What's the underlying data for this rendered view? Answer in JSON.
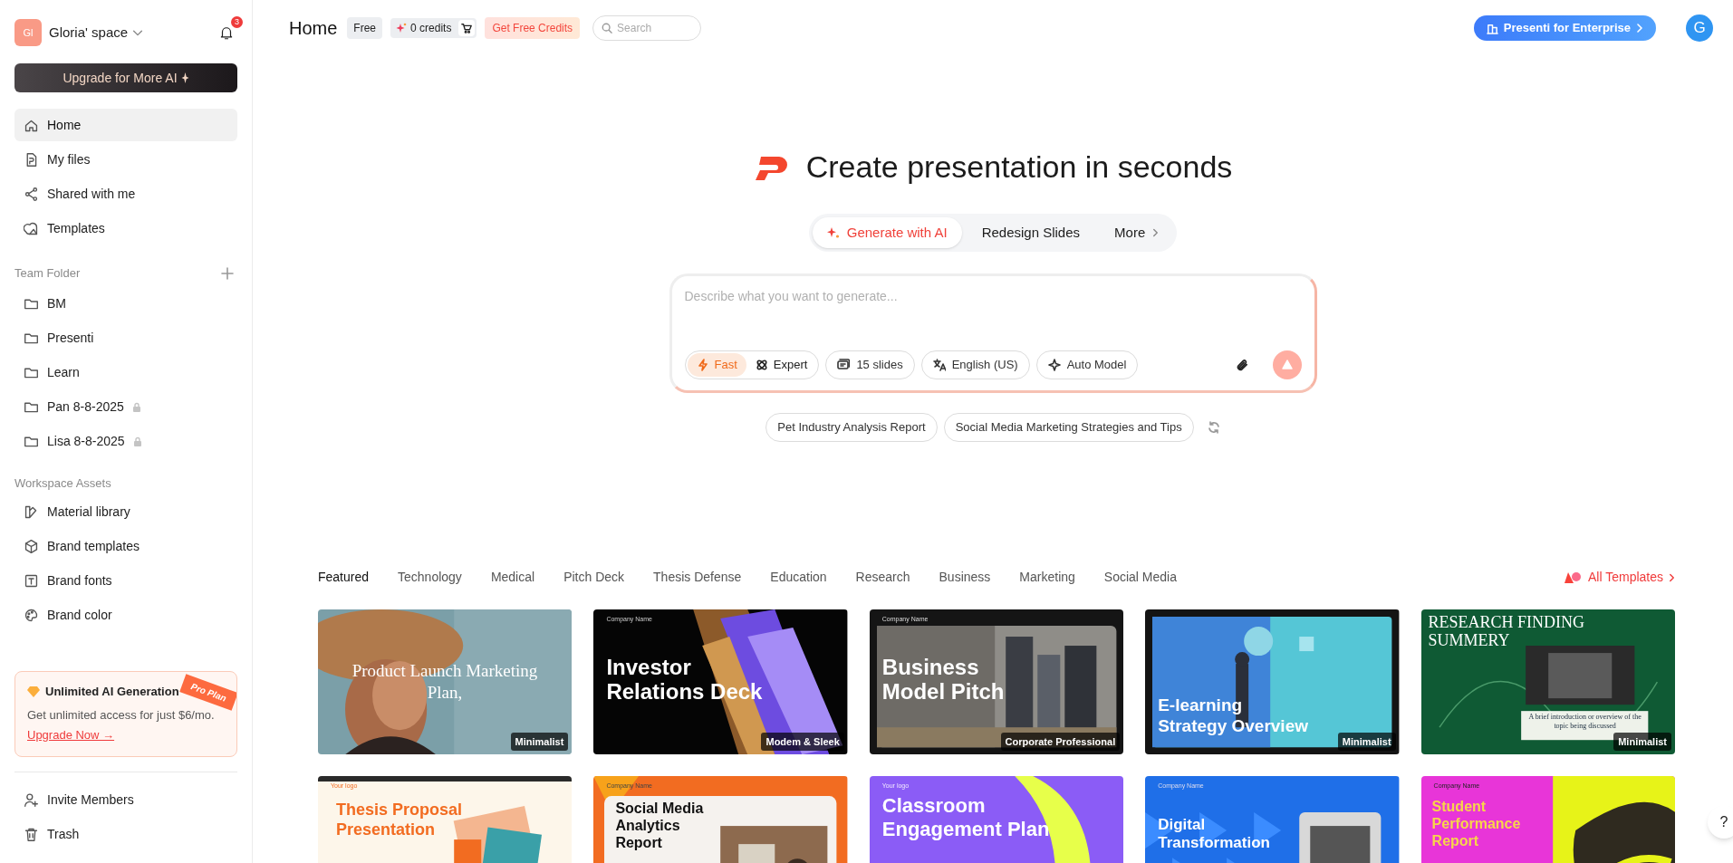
{
  "workspace": {
    "avatar": "Gl",
    "name": "Gloria' space",
    "notifications": "3"
  },
  "upgrade_button": "Upgrade for More AI",
  "nav": [
    {
      "label": "Home",
      "selected": true
    },
    {
      "label": "My files",
      "selected": false
    },
    {
      "label": "Shared with me",
      "selected": false
    },
    {
      "label": "Templates",
      "selected": false
    }
  ],
  "team_folder": {
    "title": "Team Folder",
    "items": [
      {
        "label": "BM",
        "locked": false
      },
      {
        "label": "Presenti",
        "locked": false
      },
      {
        "label": "Learn",
        "locked": false
      },
      {
        "label": "Pan 8-8-2025",
        "locked": true
      },
      {
        "label": "Lisa 8-8-2025",
        "locked": true
      }
    ]
  },
  "workspace_assets": {
    "title": "Workspace Assets",
    "items": [
      "Material library",
      "Brand templates",
      "Brand fonts",
      "Brand color"
    ]
  },
  "promo": {
    "title": "Unlimited AI Generation",
    "text": "Get unlimited access for just $6/mo.",
    "link": "Upgrade Now →",
    "ribbon": "Pro Plan"
  },
  "bottom_nav": [
    "Invite Members",
    "Trash"
  ],
  "topbar": {
    "title": "Home",
    "plan": "Free",
    "credits": "0 credits",
    "free_credits": "Get Free Credits",
    "search_placeholder": "Search",
    "enterprise": "Presenti for Enterprise",
    "user_initial": "G"
  },
  "hero": {
    "title": "Create presentation in seconds",
    "modes": [
      {
        "label": "Generate with AI",
        "selected": true
      },
      {
        "label": "Redesign Slides",
        "selected": false
      },
      {
        "label": "More",
        "selected": false
      }
    ],
    "prompt": {
      "placeholder": "Describe what you want to generate...",
      "speed": [
        {
          "label": "Fast",
          "selected": true
        },
        {
          "label": "Expert",
          "selected": false
        }
      ],
      "options": [
        "15 slides",
        "English (US)",
        "Auto Model"
      ]
    },
    "suggestions": [
      "Pet Industry Analysis Report",
      "Social Media Marketing Strategies and Tips"
    ]
  },
  "templates": {
    "categories": [
      {
        "label": "Featured",
        "selected": true
      },
      {
        "label": "Technology",
        "selected": false
      },
      {
        "label": "Medical",
        "selected": false
      },
      {
        "label": "Pitch Deck",
        "selected": false
      },
      {
        "label": "Thesis Defense",
        "selected": false
      },
      {
        "label": "Education",
        "selected": false
      },
      {
        "label": "Research",
        "selected": false
      },
      {
        "label": "Business",
        "selected": false
      },
      {
        "label": "Marketing",
        "selected": false
      },
      {
        "label": "Social Media",
        "selected": false
      }
    ],
    "all_link": "All Templates",
    "cards": [
      {
        "kind": "portrait",
        "title": "Product Launch Marketing Plan,",
        "tag": "Minimalist"
      },
      {
        "kind": "waves",
        "title": "Investor Relations Deck",
        "small": "Company Name",
        "tag": "Modem & Sleek"
      },
      {
        "kind": "city",
        "title": "Business Model Pitch",
        "small": "Company Name",
        "tag": "Corporate Professional"
      },
      {
        "kind": "learning",
        "title": "E-learning Strategy Overview",
        "tag": "Minimalist"
      },
      {
        "kind": "research",
        "title": "RESEARCH FINDING SUMMERY",
        "subtitle": "A brief introduction or overview of the topic being discussed",
        "tag": "Minimalist"
      },
      {
        "kind": "proposal",
        "title": "Thesis Proposal Presentation",
        "small": "Your logo"
      },
      {
        "kind": "analytics",
        "title": "Social Media Analytics Report",
        "small": "Company Name"
      },
      {
        "kind": "classroom",
        "title": "Classroom Engagement Plan",
        "small": "Your logo"
      },
      {
        "kind": "digital",
        "title": "Digital Transformation",
        "small": "Company Name"
      },
      {
        "kind": "student",
        "title": "Student Performance Report",
        "small": "Company Name"
      }
    ]
  },
  "help": "?"
}
